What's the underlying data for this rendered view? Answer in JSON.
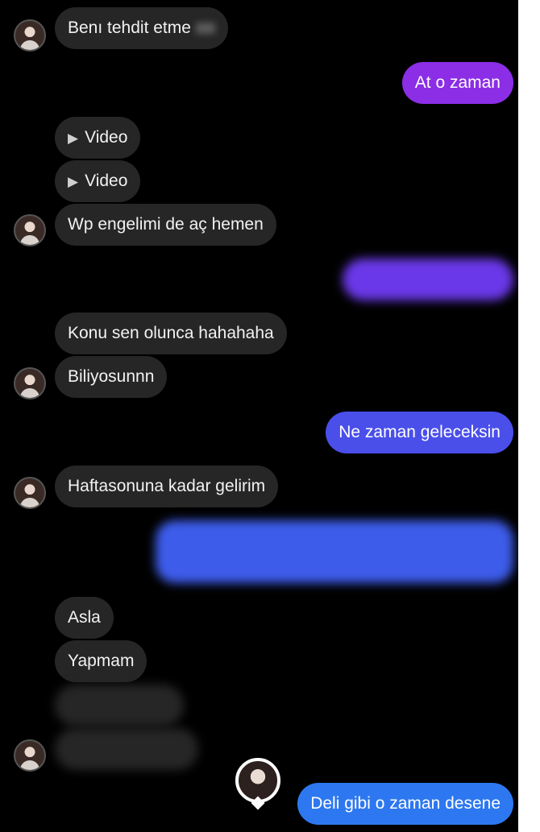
{
  "colors": {
    "background": "#000000",
    "incoming_bubble": "#262626",
    "outgoing_purple": "#8b2ee6",
    "outgoing_indigo": "#5c3de8",
    "outgoing_blue": "#3f58ea",
    "outgoing_light_blue": "#2d78f0"
  },
  "messages": {
    "m1": {
      "text": "Benı tehdit etme",
      "from": "them"
    },
    "m2": {
      "text": "At o zaman",
      "from": "me"
    },
    "m3": {
      "text": "Video",
      "from": "them",
      "type": "video"
    },
    "m4": {
      "text": "Video",
      "from": "them",
      "type": "video"
    },
    "m5": {
      "text": "Wp engelimi de aç hemen",
      "from": "them"
    },
    "m6": {
      "text": "",
      "from": "me",
      "redacted": true
    },
    "m7": {
      "text": "Konu sen olunca hahahaha",
      "from": "them"
    },
    "m8": {
      "text": "Biliyosunnn",
      "from": "them"
    },
    "m9": {
      "text": "Ne zaman geleceksin",
      "from": "me"
    },
    "m10": {
      "text": "Haftasonuna kadar gelirim",
      "from": "them"
    },
    "m11": {
      "text": "",
      "from": "me",
      "redacted": true
    },
    "m12": {
      "text": "Asla",
      "from": "them"
    },
    "m13": {
      "text": "Yapmam",
      "from": "them"
    },
    "m14": {
      "text": "",
      "from": "them",
      "redacted": true
    },
    "m15": {
      "text": "",
      "from": "them",
      "redacted": true
    },
    "m16": {
      "text": "Deli gibi o zaman desene",
      "from": "me"
    }
  },
  "icons": {
    "play": "play-icon",
    "avatar": "contact-avatar",
    "seen": "seen-avatar"
  }
}
